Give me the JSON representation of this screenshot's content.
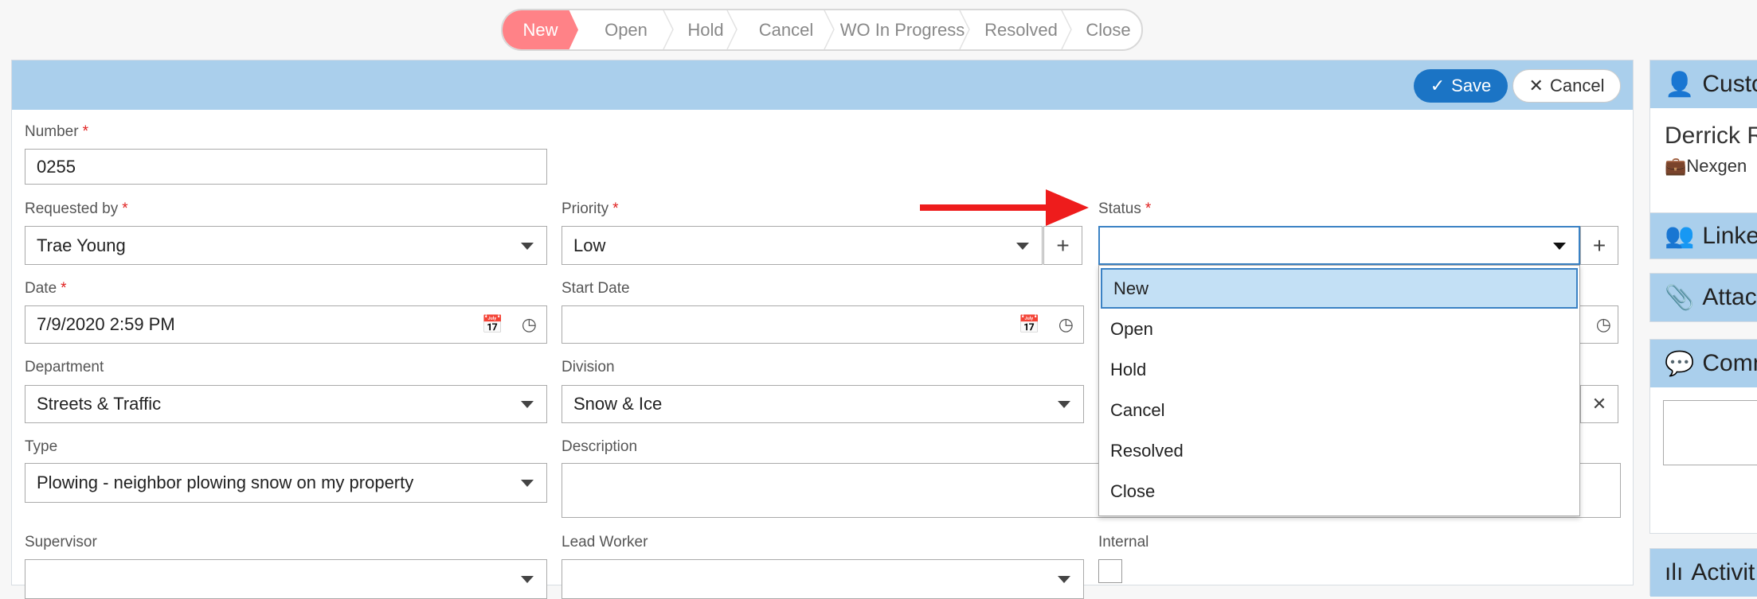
{
  "stages": [
    {
      "label": "New",
      "active": true
    },
    {
      "label": "Open"
    },
    {
      "label": "Hold"
    },
    {
      "label": "Cancel"
    },
    {
      "label": "WO In Progress"
    },
    {
      "label": "Resolved"
    },
    {
      "label": "Close"
    }
  ],
  "toolbar": {
    "save_label": "Save",
    "cancel_label": "Cancel"
  },
  "form": {
    "number": {
      "label": "Number",
      "value": "0255"
    },
    "requested_by": {
      "label": "Requested by",
      "value": "Trae Young"
    },
    "priority": {
      "label": "Priority",
      "value": "Low"
    },
    "status": {
      "label": "Status",
      "value": "",
      "options": [
        "New",
        "Open",
        "Hold",
        "Cancel",
        "Resolved",
        "Close"
      ],
      "highlighted": "New"
    },
    "date": {
      "label": "Date",
      "value": "7/9/2020 2:59 PM"
    },
    "start_date": {
      "label": "Start Date",
      "value": ""
    },
    "department": {
      "label": "Department",
      "value": "Streets & Traffic"
    },
    "division": {
      "label": "Division",
      "value": "Snow & Ice"
    },
    "type": {
      "label": "Type",
      "value": "Plowing - neighbor plowing snow on my property"
    },
    "description": {
      "label": "Description",
      "value": ""
    },
    "supervisor": {
      "label": "Supervisor",
      "value": ""
    },
    "lead_worker": {
      "label": "Lead Worker",
      "value": ""
    },
    "internal": {
      "label": "Internal",
      "checked": false
    },
    "required_mark": "*"
  },
  "sidebar": {
    "customer": {
      "title": "Custo",
      "name": "Derrick R",
      "company": "Nexgen"
    },
    "linked": {
      "title": "Linke"
    },
    "attachments": {
      "title": "Attach"
    },
    "comments": {
      "title": "Comm"
    },
    "activity": {
      "title": "Activit"
    }
  },
  "colors": {
    "active_stage": "#ff8287",
    "header": "#aacfec",
    "save": "#1b74c5",
    "arrow": "#ee1c1c",
    "highlight": "#c3e0f5"
  }
}
